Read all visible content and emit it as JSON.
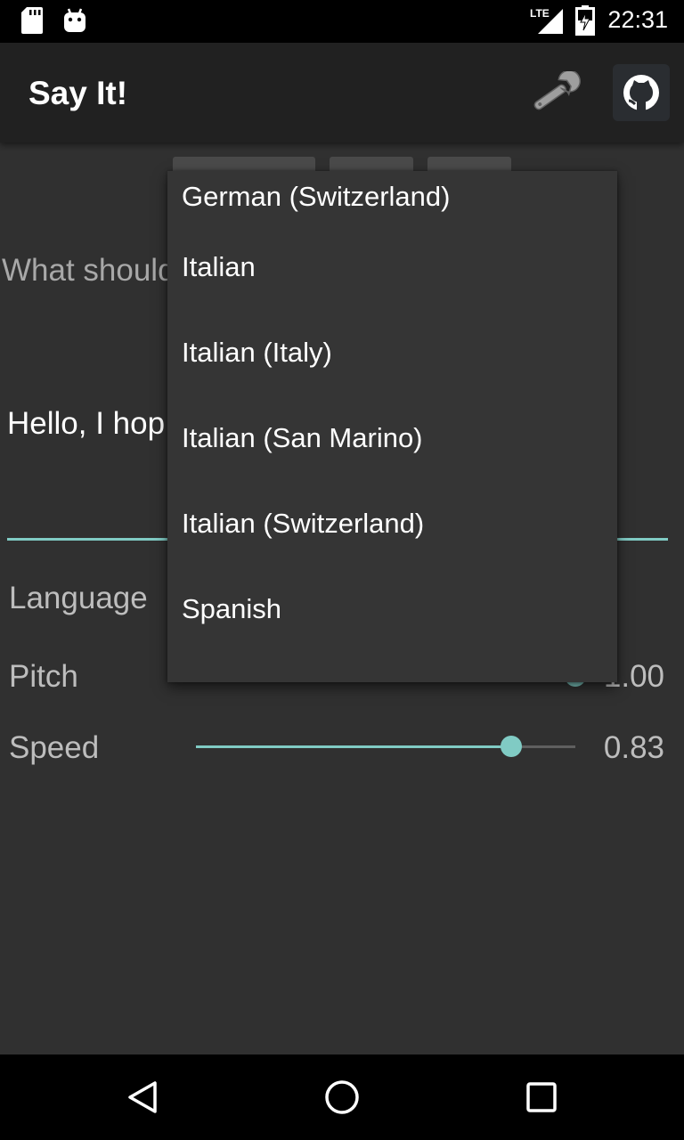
{
  "status_bar": {
    "time": "22:31",
    "icons": [
      "sd-card-icon",
      "android-icon",
      "lte-signal-icon",
      "battery-charging-icon"
    ],
    "network": "LTE"
  },
  "app_bar": {
    "title": "Say It!",
    "actions": [
      "wrench-icon",
      "github-icon"
    ]
  },
  "main": {
    "prompt_label": "What should",
    "speech_text": "Hello, I hop",
    "language_label": "Language",
    "pitch": {
      "label": "Pitch",
      "value_text": "1.00"
    },
    "speed": {
      "label": "Speed",
      "value_text": "0.83",
      "fraction": 0.83
    }
  },
  "language_dropdown": {
    "options": [
      "German (Switzerland)",
      "Italian",
      "Italian (Italy)",
      "Italian (San Marino)",
      "Italian (Switzerland)",
      "Spanish"
    ]
  },
  "colors": {
    "accent": "#80cbc4",
    "background": "#303030",
    "app_bar": "#212121",
    "menu": "#353535"
  },
  "nav_bar": {
    "buttons": [
      "back-icon",
      "home-icon",
      "recents-icon"
    ]
  }
}
